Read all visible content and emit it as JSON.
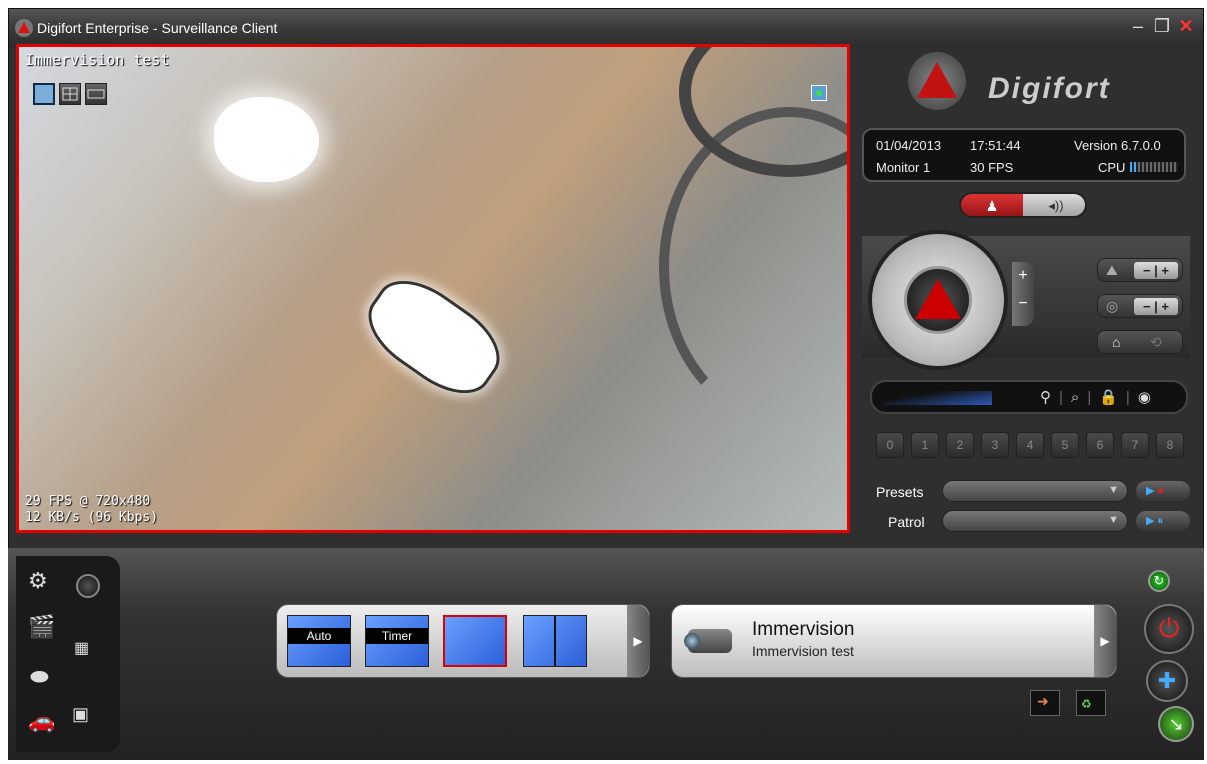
{
  "window": {
    "title": "Digifort Enterprise - Surveillance Client"
  },
  "video": {
    "camera_label": "Immervision test",
    "fps_info": "29 FPS @ 720x480",
    "bitrate_info": "12 KB/s (96 Kbps)"
  },
  "logo": {
    "text": "Digifort"
  },
  "status": {
    "date": "01/04/2013",
    "time": "17:51:44",
    "version": "Version 6.7.0.0",
    "monitor": "Monitor 1",
    "fps": "30 FPS",
    "cpu_label": "CPU"
  },
  "ptz": {
    "zoom_plus": "+",
    "zoom_minus": "−",
    "numbers": [
      "0",
      "1",
      "2",
      "3",
      "4",
      "5",
      "6",
      "7",
      "8"
    ],
    "presets_label": "Presets",
    "patrol_label": "Patrol"
  },
  "sequence": {
    "items": [
      {
        "label": "Auto"
      },
      {
        "label": "Timer"
      }
    ]
  },
  "camera_panel": {
    "title": "Immervision",
    "subtitle": "Immervision test"
  },
  "colors": {
    "accent_red": "#e20000",
    "highlight_blue": "#2b5fd8"
  }
}
